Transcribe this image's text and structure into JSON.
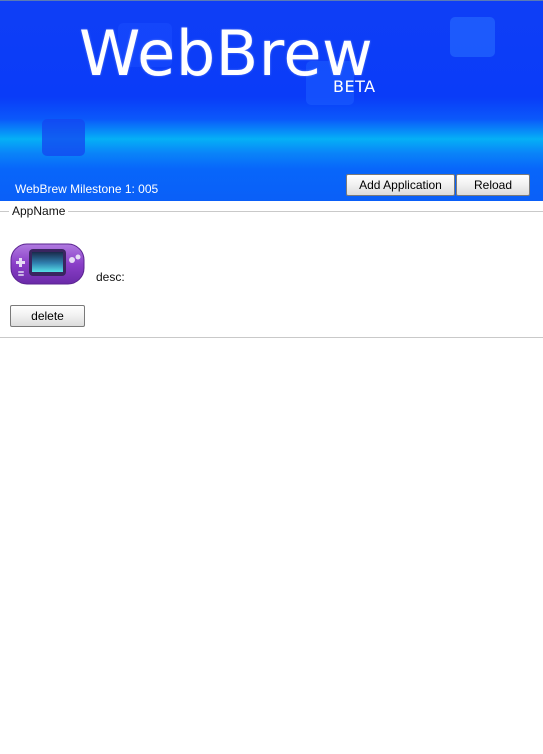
{
  "header": {
    "logo_title": "WebBrew",
    "logo_subtitle": "BETA",
    "milestone": "WebBrew Milestone 1: 005",
    "colors": {
      "banner_blue": "#0a3cf8",
      "banner_highlight": "#05b0f6"
    }
  },
  "toolbar": {
    "add_application_label": "Add Application",
    "reload_label": "Reload"
  },
  "apps": [
    {
      "name": "AppName",
      "icon": "handheld-console-icon",
      "description": "desc:",
      "delete_label": "delete",
      "icon_color": "#8a3fc8"
    }
  ]
}
